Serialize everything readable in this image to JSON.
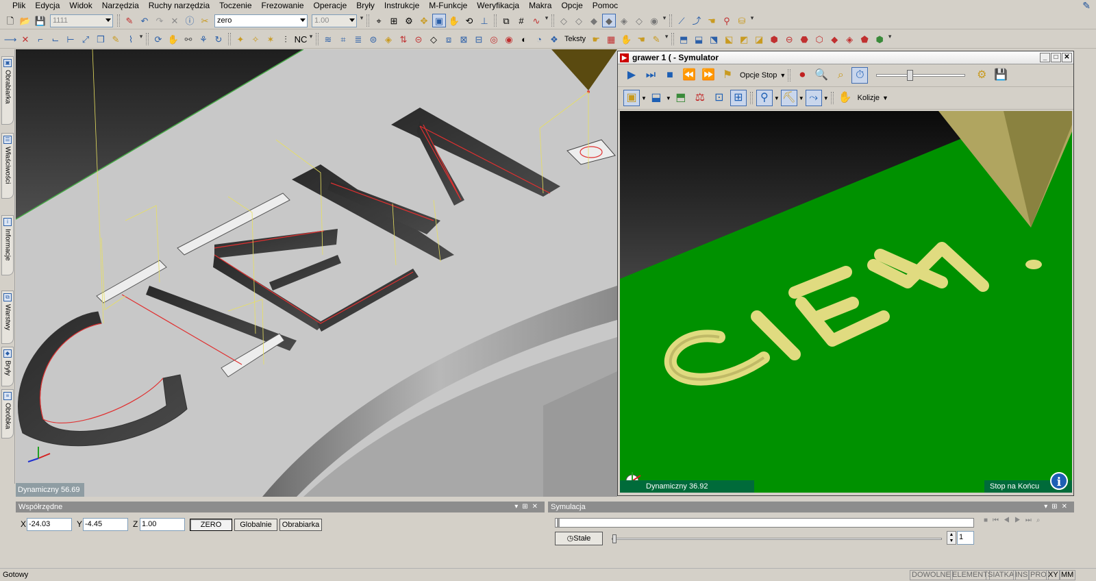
{
  "menu": [
    "Plik",
    "Edycja",
    "Widok",
    "Narzędzia",
    "Ruchy narzędzia",
    "Toczenie",
    "Frezowanie",
    "Operacje",
    "Bryły",
    "Instrukcje",
    "M-Funkcje",
    "Weryfikacja",
    "Makra",
    "Opcje",
    "Pomoc"
  ],
  "toolbar": {
    "layer_combo": "1111",
    "workplane_combo": "zero",
    "value_combo": "1.00",
    "texts_label": "Teksty"
  },
  "side_tabs": [
    "Obrabiarka",
    "Właściwości",
    "Informacje",
    "Warstwy",
    "Bryły",
    "Obróbka"
  ],
  "viewport": {
    "status": "Dynamiczny 56.69"
  },
  "simulator": {
    "title": "grawer 1 ( - Symulator",
    "stop_options": "Opcje Stop",
    "collisions": "Kolizje",
    "view_status": "Dynamiczny 36.92",
    "end_status": "Stop na Końcu"
  },
  "coords": {
    "title": "Współrzędne",
    "x_label": "X",
    "x_value": "-24.03",
    "y_label": "Y",
    "y_value": "-4.45",
    "z_label": "Z",
    "z_value": "1.00",
    "zero_btn": "ZERO",
    "global_btn": "Globalnie",
    "machine_btn": "Obrabiarka"
  },
  "simulation_panel": {
    "title": "Symulacja",
    "mode_btn": "Stałe",
    "step_value": "1"
  },
  "status": {
    "ready": "Gotowy",
    "cells": [
      "DOWOLNE",
      "ELEMENT",
      "SIATKA",
      "INS",
      "PRO",
      "XY",
      "MM"
    ]
  },
  "colors": {
    "sim_floor": "#009100",
    "engrave": "#e0db80",
    "toolpath": "#e8e060"
  }
}
